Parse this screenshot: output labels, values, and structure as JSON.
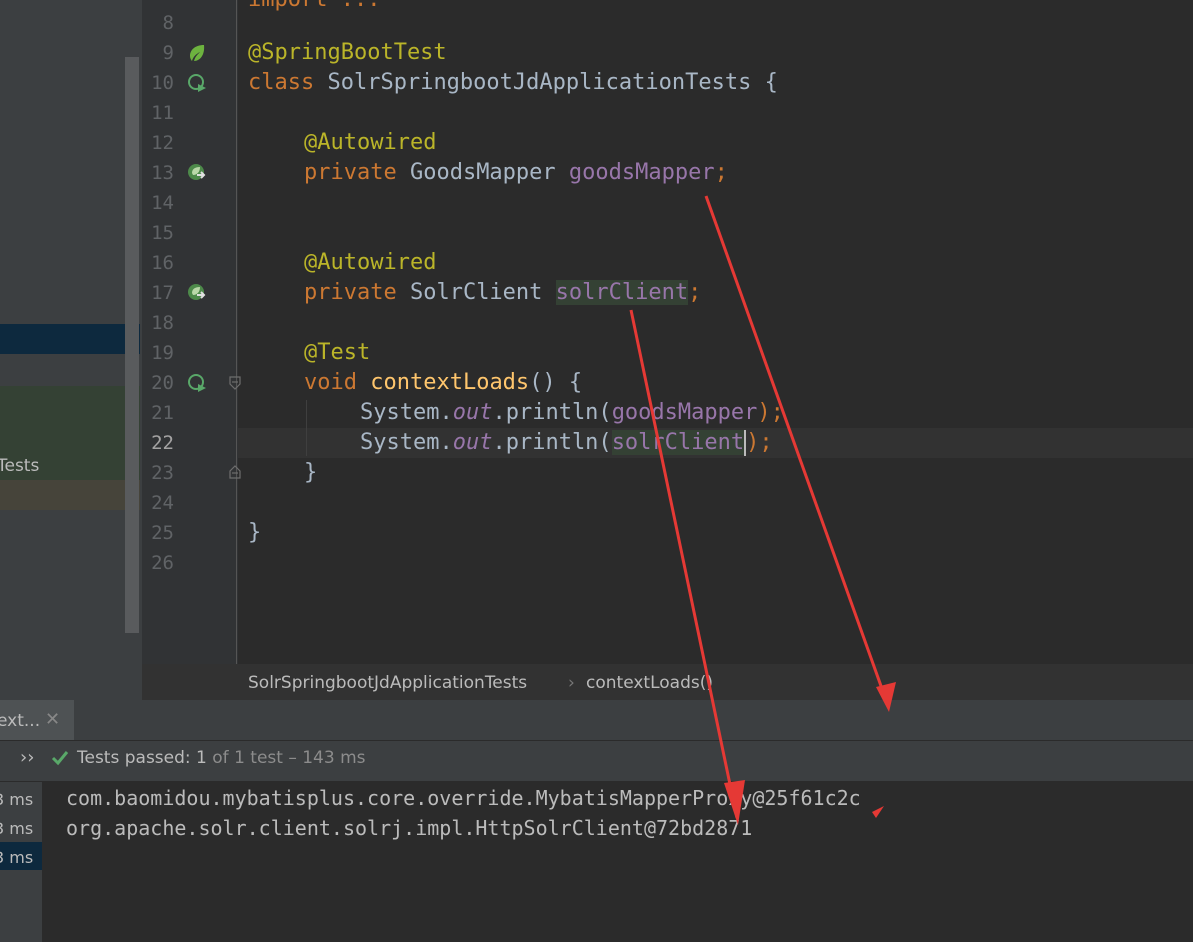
{
  "editor": {
    "line_numbers": [
      "8",
      "9",
      "10",
      "11",
      "12",
      "13",
      "14",
      "15",
      "16",
      "17",
      "18",
      "19",
      "20",
      "21",
      "22",
      "23",
      "24",
      "25",
      "26"
    ],
    "current_line": "22",
    "top_partial": "import ...",
    "code": {
      "l9_annotation": "@SpringBootTest",
      "l10_kw": "class",
      "l10_name": " SolrSpringbootJdApplicationTests {",
      "l12_annotation": "@Autowired",
      "l13_kw": "private",
      "l13_type": " GoodsMapper ",
      "l13_field": "goodsMapper",
      "l13_semi": ";",
      "l16_annotation": "@Autowired",
      "l17_kw": "private",
      "l17_type": " SolrClient ",
      "l17_field": "solrClient",
      "l17_semi": ";",
      "l19_annotation": "@Test",
      "l20_kw": "void",
      "l20_method": "contextLoads",
      "l20_rest": "() {",
      "l21_a": "System.",
      "l21_out": "out",
      "l21_b": ".println(",
      "l21_field": "goodsMapper",
      "l21_c": ");",
      "l22_a": "System.",
      "l22_out": "out",
      "l22_b": ".println(",
      "l22_field": "solrClient",
      "l22_c": ");",
      "l23_brace": "}",
      "l25_brace": "}"
    }
  },
  "project_panel": {
    "partial_label": "Tests"
  },
  "breadcrumb": {
    "class_name": "SolrSpringbootJdApplicationTests",
    "separator": "›",
    "method": "contextLoads()"
  },
  "run_panel": {
    "tab_label": "ext...",
    "close_icon": "close-icon",
    "chevron": "››",
    "status_prefix": "Tests passed: ",
    "status_count": "1",
    "status_suffix": " of 1 test – 143 ms",
    "durations": [
      "3 ms",
      "3 ms",
      "3 ms"
    ],
    "console_lines": [
      "com.baomidou.mybatisplus.core.override.MybatisMapperProxy@25f61c2c",
      "org.apache.solr.client.solrj.impl.HttpSolrClient@72bd2871"
    ]
  },
  "colors": {
    "background": "#2b2b2b",
    "keyword": "#cc7832",
    "annotation": "#bbb529",
    "field": "#9876aa",
    "method": "#ffc66d",
    "arrow": "#e53935"
  }
}
